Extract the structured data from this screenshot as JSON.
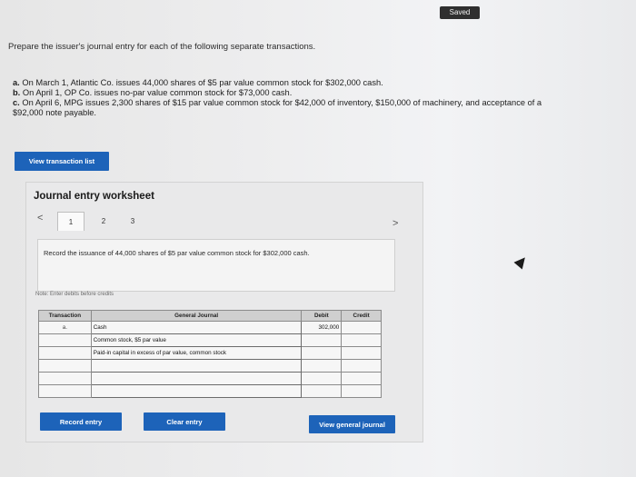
{
  "status": {
    "saved_label": "Saved"
  },
  "question": {
    "instructions": "Prepare the issuer's journal entry for each of the following separate transactions.",
    "transactions": [
      {
        "letter": "a.",
        "text": "On March 1, Atlantic Co. issues 44,000 shares of $5 par value common stock for $302,000 cash."
      },
      {
        "letter": "b.",
        "text": "On April 1, OP Co. issues no-par value common stock for $73,000 cash."
      },
      {
        "letter": "c.",
        "text": "On April 6, MPG issues 2,300 shares of $15 par value common stock for $42,000 of inventory, $150,000 of machinery, and acceptance of a $92,000 note payable."
      }
    ]
  },
  "buttons": {
    "view_transaction_list": "View transaction list",
    "record_entry": "Record entry",
    "clear_entry": "Clear entry",
    "view_general_journal": "View general journal"
  },
  "worksheet": {
    "title": "Journal entry worksheet",
    "nav_prev": "<",
    "nav_next": ">",
    "tabs": [
      "1",
      "2",
      "3"
    ],
    "active_tab": "1",
    "description": "Record the issuance of 44,000 shares of $5 par value common stock for $302,000 cash.",
    "note": "Note: Enter debits before credits",
    "table": {
      "headers": {
        "transaction": "Transaction",
        "general_journal": "General Journal",
        "debit": "Debit",
        "credit": "Credit"
      },
      "rows": [
        {
          "transaction": "a.",
          "account": "Cash",
          "debit": "302,000",
          "credit": ""
        },
        {
          "transaction": "",
          "account": "Common stock, $5 par value",
          "debit": "",
          "credit": ""
        },
        {
          "transaction": "",
          "account": "Paid-in capital in excess of par value, common stock",
          "debit": "",
          "credit": ""
        },
        {
          "transaction": "",
          "account": "",
          "debit": "",
          "credit": ""
        },
        {
          "transaction": "",
          "account": "",
          "debit": "",
          "credit": ""
        },
        {
          "transaction": "",
          "account": "",
          "debit": "",
          "credit": ""
        }
      ]
    }
  }
}
